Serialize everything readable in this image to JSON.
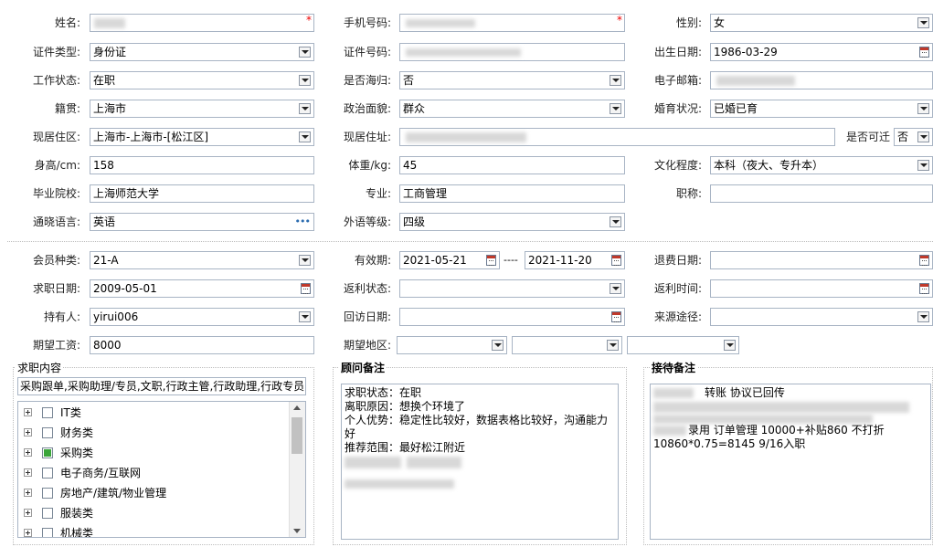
{
  "form": {
    "name_label": "姓名:",
    "mobile_label": "手机号码:",
    "gender_label": "性别:",
    "gender_value": "女",
    "idtype_label": "证件类型:",
    "idtype_value": "身份证",
    "idno_label": "证件号码:",
    "birth_label": "出生日期:",
    "birth_value": "1986-03-29",
    "workstatus_label": "工作状态:",
    "workstatus_value": "在职",
    "returnee_label": "是否海归:",
    "returnee_value": "否",
    "email_label": "电子邮箱:",
    "native_label": "籍贯:",
    "native_value": "上海市",
    "political_label": "政治面貌:",
    "political_value": "群众",
    "marital_label": "婚育状况:",
    "marital_value": "已婚已育",
    "residence_label": "现居住区:",
    "residence_value": "上海市-上海市-[松江区]",
    "address_label": "现居住址:",
    "relocate_label": "是否可迁",
    "relocate_value": "否",
    "height_label": "身高/cm:",
    "height_value": "158",
    "weight_label": "体重/kg:",
    "weight_value": "45",
    "education_label": "文化程度:",
    "education_value": "本科（夜大、专升本）",
    "school_label": "毕业院校:",
    "school_value": "上海师范大学",
    "major_label": "专业:",
    "major_value": "工商管理",
    "title_label": "职称:",
    "language_label": "通晓语言:",
    "language_value": "英语",
    "language_more": "•••",
    "langlevel_label": "外语等级:",
    "langlevel_value": "四级"
  },
  "member": {
    "type_label": "会员种类:",
    "type_value": "21-A",
    "validity_label": "有效期:",
    "valid_from": "2021-05-21",
    "valid_sep": "----",
    "valid_to": "2021-11-20",
    "refund_label": "退费日期:",
    "jobdate_label": "求职日期:",
    "jobdate_value": "2009-05-01",
    "rebate_status_label": "返利状态:",
    "rebate_time_label": "返利时间:",
    "holder_label": "持有人:",
    "holder_value": "yirui006",
    "visit_label": "回访日期:",
    "source_label": "来源途径:",
    "salary_label": "期望工资:",
    "salary_value": "8000",
    "area_label": "期望地区:"
  },
  "job_content": {
    "legend": "求职内容",
    "summary": "采购跟单,采购助理/专员,文职,行政主管,行政助理,行政专员",
    "categories": [
      "IT类",
      "财务类",
      "采购类",
      "电子商务/互联网",
      "房地产/建筑/物业管理",
      "服装类",
      "机械类"
    ],
    "checked_index": 2
  },
  "advisor_notes": {
    "legend": "顾问备注",
    "lines": [
      "求职状态：在职",
      "离职原因：想换个环境了",
      "个人优势：稳定性比较好，数据表格比较好，沟通能力好",
      "推荐范围：最好松江附近"
    ]
  },
  "reception_notes": {
    "legend": "接待备注",
    "line1": "转账 协议已回传",
    "line2": "录用  订单管理 10000+补贴860  不打折",
    "line3": "10860*0.75=8145  9/16入职"
  },
  "colors": {
    "required": "#ee0000",
    "checked": "#3aa53a",
    "border": "#a8b4c4"
  }
}
